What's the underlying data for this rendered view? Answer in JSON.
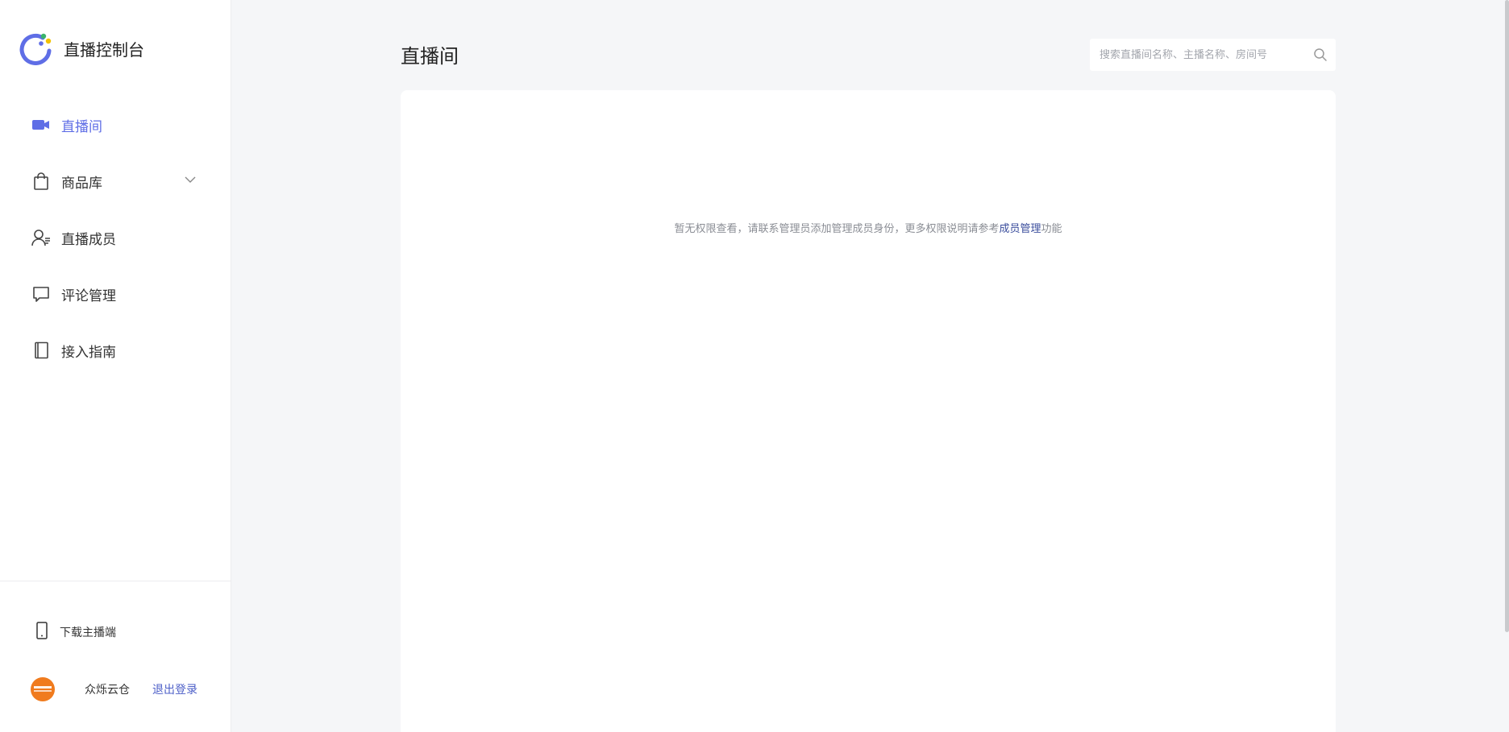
{
  "app": {
    "title": "直播控制台"
  },
  "sidebar": {
    "items": [
      {
        "label": "直播间",
        "icon": "video-camera-icon",
        "active": true
      },
      {
        "label": "商品库",
        "icon": "shopping-bag-icon",
        "expandable": true
      },
      {
        "label": "直播成员",
        "icon": "member-icon"
      },
      {
        "label": "评论管理",
        "icon": "comment-icon"
      },
      {
        "label": "接入指南",
        "icon": "book-icon"
      }
    ],
    "download_label": "下载主播端",
    "user": {
      "name": "众烁云仓",
      "logout_label": "退出登录"
    }
  },
  "main": {
    "title": "直播间",
    "search": {
      "placeholder": "搜索直播间名称、主播名称、房间号"
    },
    "notice": {
      "prefix": "暂无权限查看，请联系管理员添加管理成员身份，更多权限说明请参考",
      "link": "成员管理",
      "suffix": "功能"
    }
  },
  "colors": {
    "accent": "#5f6ee6",
    "link": "#3a4d9c",
    "avatar": "#f07b1e",
    "background": "#f5f6f8"
  }
}
